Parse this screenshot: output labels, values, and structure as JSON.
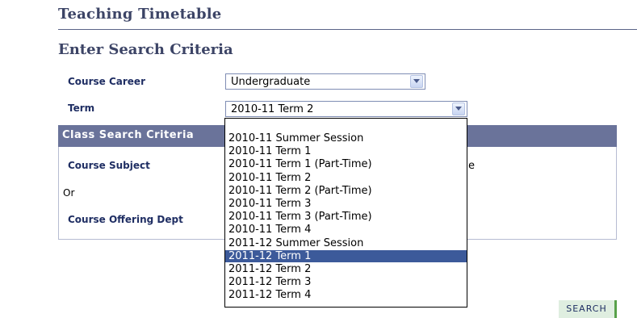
{
  "page": {
    "title": "Teaching Timetable",
    "section_heading": "Enter Search Criteria"
  },
  "form": {
    "course_career": {
      "label": "Course Career",
      "value": "Undergraduate"
    },
    "term": {
      "label": "Term",
      "value": "2010-11 Term 2",
      "options": [
        "",
        "2010-11 Summer Session",
        "2010-11 Term 1",
        "2010-11 Term 1 (Part-Time)",
        "2010-11 Term 2",
        "2010-11 Term 2 (Part-Time)",
        "2010-11 Term 3",
        "2010-11 Term 3 (Part-Time)",
        "2010-11 Term 4",
        "2011-12 Summer Session",
        "2011-12 Term 1",
        "2011-12 Term 2",
        "2011-12 Term 3",
        "2011-12 Term 4"
      ],
      "highlighted_option": "2011-12 Term 1"
    }
  },
  "class_search": {
    "header": "Class Search Criteria",
    "course_subject_label": "Course Subject",
    "or_text": "Or",
    "course_offering_dept_label": "Course Offering Dept",
    "partially_visible_text": "e"
  },
  "actions": {
    "search_label": "SEARCH"
  },
  "colors": {
    "heading": "#3c4466",
    "label": "#1f2e63",
    "panel_header": "#6a739a",
    "highlight": "#3c5a9a",
    "search_button_bg": "#dfeee0",
    "search_button_accent": "#58a14a"
  }
}
